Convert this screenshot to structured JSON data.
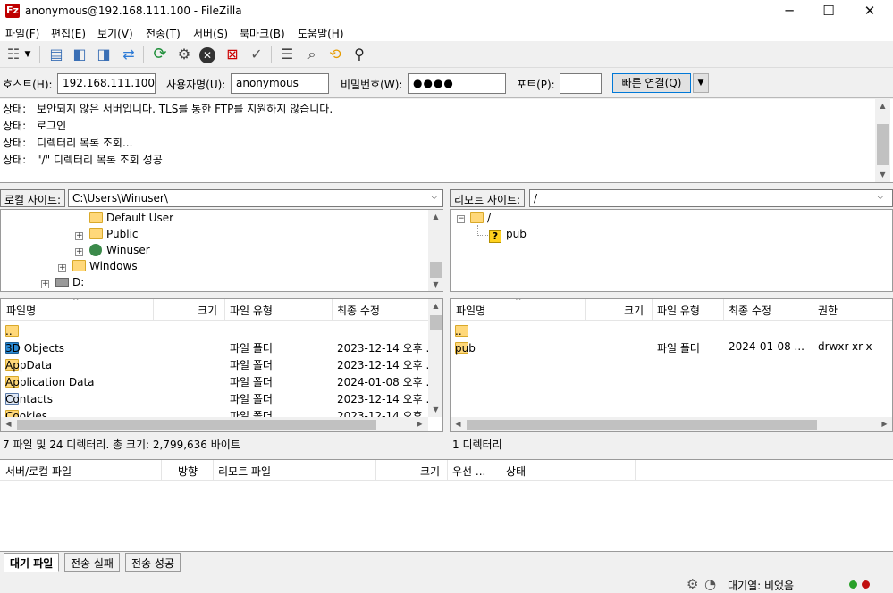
{
  "window": {
    "title": "anonymous@192.168.111.100 - FileZilla",
    "app_icon": "Fz",
    "minimize": "─",
    "maximize": "☐",
    "close": "✕"
  },
  "menu": [
    "파일(F)",
    "편집(E)",
    "보기(V)",
    "전송(T)",
    "서버(S)",
    "북마크(B)",
    "도움말(H)"
  ],
  "quickconnect": {
    "host_label": "호스트(H):",
    "host_value": "192.168.111.100",
    "user_label": "사용자명(U):",
    "user_value": "anonymous",
    "pass_label": "비밀번호(W):",
    "pass_value": "●●●●",
    "port_label": "포트(P):",
    "port_value": "",
    "button": "빠른 연결(Q)"
  },
  "log": [
    {
      "key": "상태:",
      "text": "보안되지 않은 서버입니다. TLS를 통한 FTP를 지원하지 않습니다."
    },
    {
      "key": "상태:",
      "text": "로그인"
    },
    {
      "key": "상태:",
      "text": "디렉터리 목록 조회..."
    },
    {
      "key": "상태:",
      "text": "\"/\" 디렉터리 목록 조회 성공"
    }
  ],
  "local": {
    "site_label": "로컬 사이트:",
    "site_path": "C:\\Users\\Winuser\\",
    "tree": [
      "Default User",
      "Public",
      "Winuser",
      "Windows",
      "D:"
    ],
    "columns": [
      "파일명",
      "크기",
      "파일 유형",
      "최종 수정"
    ],
    "files": [
      {
        "name": "..",
        "type": "",
        "modified": ""
      },
      {
        "name": "3D Objects",
        "type": "파일 폴더",
        "modified": "2023-12-14 오후 ..."
      },
      {
        "name": "AppData",
        "type": "파일 폴더",
        "modified": "2023-12-14 오후 ..."
      },
      {
        "name": "Application Data",
        "type": "파일 폴더",
        "modified": "2024-01-08 오후 ..."
      },
      {
        "name": "Contacts",
        "type": "파일 폴더",
        "modified": "2023-12-14 오후 ..."
      },
      {
        "name": "Cookies",
        "type": "파일 폴더",
        "modified": "2023-12-14 오후 ..."
      }
    ],
    "status": "7 파일 및 24 디렉터리. 총 크기: 2,799,636 바이트"
  },
  "remote": {
    "site_label": "리모트 사이트:",
    "site_path": "/",
    "tree": [
      "/",
      "pub"
    ],
    "unknown_mark": "?",
    "columns": [
      "파일명",
      "크기",
      "파일 유형",
      "최종 수정",
      "권한"
    ],
    "files": [
      {
        "name": "..",
        "type": "",
        "modified": "",
        "perm": ""
      },
      {
        "name": "pub",
        "type": "파일 폴더",
        "modified": "2024-01-08 ...",
        "perm": "drwxr-xr-x"
      }
    ],
    "status": "1 디렉터리"
  },
  "queue": {
    "columns": [
      "서버/로컬 파일",
      "방향",
      "리모트 파일",
      "크기",
      "우선 ...",
      "상태"
    ],
    "tabs": [
      "대기 파일",
      "전송 실패",
      "전송 성공"
    ]
  },
  "statusbar": {
    "queue_text": "대기열: 비었음"
  },
  "colors": {
    "accent": "#0078d7",
    "folder": "#ffd87a",
    "led_green": "#2aa12a",
    "led_red": "#c01010"
  }
}
